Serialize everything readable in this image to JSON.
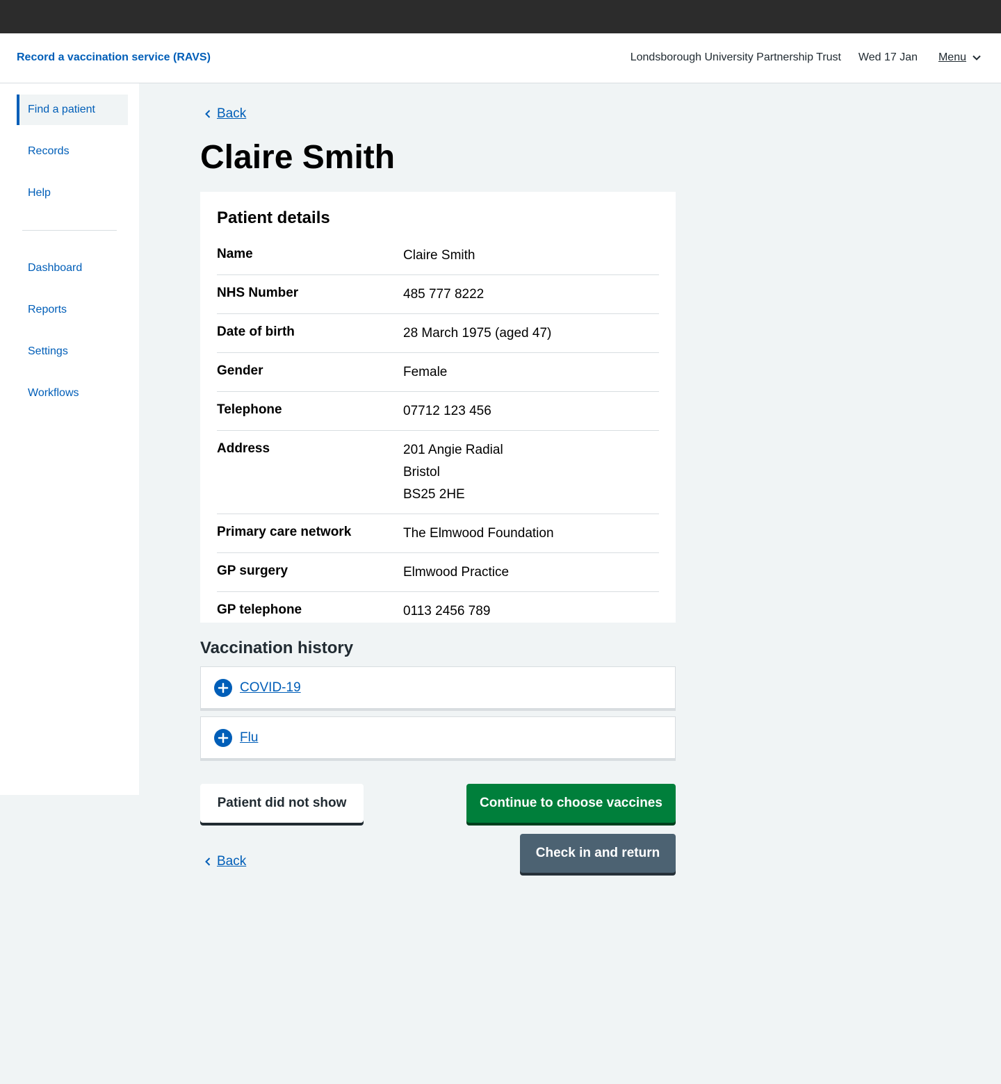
{
  "header": {
    "service_name": "Record a vaccination service (RAVS)",
    "organisation": "Londsborough University Partnership Trust",
    "date": "Wed 17 Jan",
    "menu_label": "Menu"
  },
  "sidebar": {
    "items": [
      {
        "label": "Find a patient",
        "active": true
      },
      {
        "label": "Records"
      },
      {
        "label": "Help"
      },
      {
        "label": "Dashboard"
      },
      {
        "label": "Reports"
      },
      {
        "label": "Settings"
      },
      {
        "label": "Workflows"
      }
    ]
  },
  "back_label": "Back",
  "page_title": "Claire Smith",
  "patient_details": {
    "heading": "Patient details",
    "rows": [
      {
        "key": "Name",
        "value": "Claire Smith"
      },
      {
        "key": "NHS Number",
        "value": "485 777 8222"
      },
      {
        "key": "Date of birth",
        "value": "28 March 1975 (aged 47)"
      },
      {
        "key": "Gender",
        "value": "Female"
      },
      {
        "key": "Telephone",
        "value": "07712 123 456"
      },
      {
        "key": "Address",
        "lines": [
          "201 Angie Radial",
          "Bristol",
          "BS25 2HE"
        ]
      },
      {
        "key": "Primary care network",
        "value": "The Elmwood Foundation"
      },
      {
        "key": "GP surgery",
        "value": "Elmwood Practice"
      },
      {
        "key": "GP telephone",
        "value": "0113 2456 789"
      }
    ]
  },
  "vaccination_history": {
    "heading": "Vaccination history",
    "items": [
      "COVID-19",
      "Flu"
    ]
  },
  "buttons": {
    "did_not_show": "Patient did not show",
    "continue": "Continue to choose vaccines",
    "check_in": "Check in and return"
  },
  "colors": {
    "nhs_blue": "#005eb8",
    "green": "#007f3b",
    "grey_button": "#4c6272",
    "page_bg": "#f0f4f5",
    "top_bar": "#2c2c2c"
  }
}
